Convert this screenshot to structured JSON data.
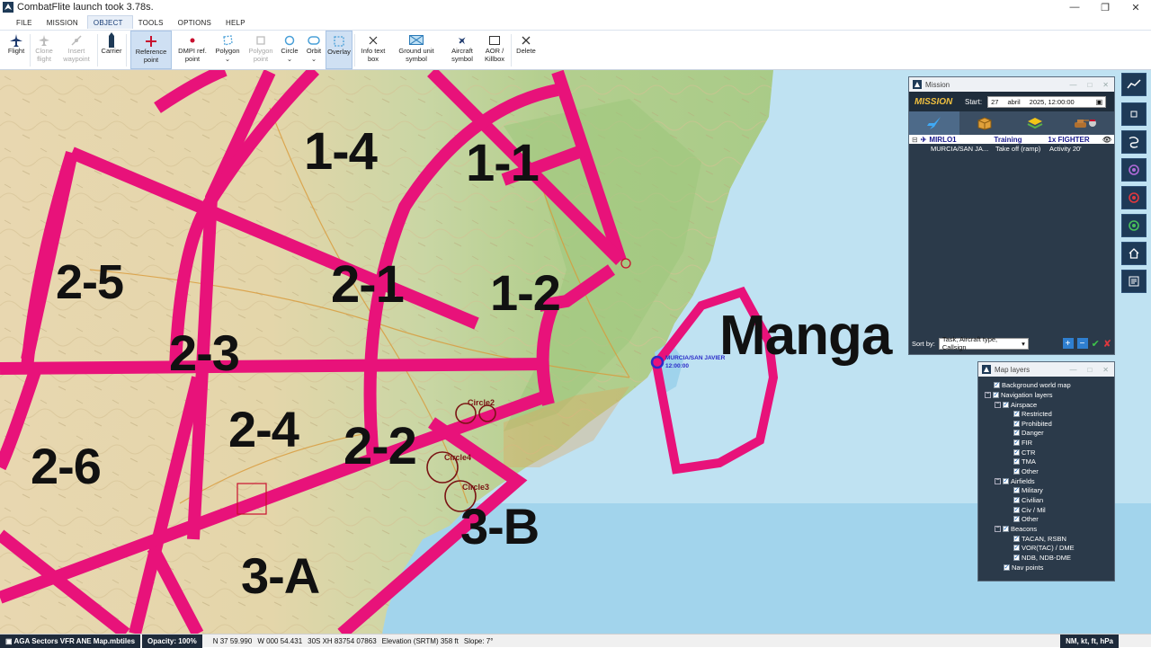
{
  "window": {
    "title": "CombatFlite launch took 3.78s."
  },
  "menu": [
    "FILE",
    "MISSION",
    "OBJECT",
    "TOOLS",
    "OPTIONS",
    "HELP"
  ],
  "ribbon": {
    "flight": "Flight",
    "clone": "Clone flight",
    "insert": "Insert waypoint",
    "carrier": "Carrier",
    "reference": "Reference point",
    "dmpi": "DMPI ref. point",
    "polygon": "Polygon",
    "polygon_point": "Polygon point",
    "circle": "Circle",
    "orbit": "Orbit",
    "overlay": "Overlay",
    "infotext": "Info text box",
    "ground": "Ground unit symbol",
    "aircraft": "Aircraft symbol",
    "aor": "AOR / Killbox",
    "delete": "Delete"
  },
  "map": {
    "sectors": [
      "1-4",
      "1-1",
      "2-5",
      "2-1",
      "1-2",
      "2-3",
      "2-4",
      "2-2",
      "2-6",
      "3-B",
      "3-A"
    ],
    "big_label": "Manga",
    "circles": [
      "Circle2",
      "Circle4",
      "Circle3"
    ],
    "airfield": "MURCIA/SAN JAVIER",
    "airfield_time": "12:00:00",
    "colors": {
      "sector": "#e8127a",
      "circle": "#7a1414",
      "water": "#bfe2f2"
    }
  },
  "mission": {
    "header": "Mission",
    "title": "MISSION",
    "start_label": "Start:",
    "day": "27",
    "month": "abril",
    "datetime": "2025, 12:00:00",
    "flight_name": "MIRLO1",
    "task": "Training",
    "aircraft": "1x FIGHTER",
    "route": "MURCIA/SAN JA...",
    "takeoff": "Take off (ramp)",
    "activity": "Activity 20'",
    "sort_label": "Sort by:",
    "sort_value": "Task, Aircraft type, Callsign"
  },
  "layers": {
    "header": "Map layers",
    "items": {
      "background": "Background world map",
      "navigation": "Navigation layers",
      "airspace": "Airspace",
      "restricted": "Restricted",
      "prohibited": "Prohibited",
      "danger": "Danger",
      "fir": "FIR",
      "ctr": "CTR",
      "tma": "TMA",
      "other1": "Other",
      "airfields": "Airfields",
      "military": "Military",
      "civilian": "Civilian",
      "civmil": "Civ / Mil",
      "other2": "Other",
      "beacons": "Beacons",
      "tacan": "TACAN, RSBN",
      "vor": "VOR(TAC) / DME",
      "ndb": "NDB, NDB-DME",
      "navpoints": "Nav points"
    }
  },
  "status": {
    "layer": "AGA Sectors VFR ANE Map.mbtiles",
    "opacity": "Opacity: 100%",
    "lat": "N 37 59.990",
    "lon": "W 000 54.431",
    "mgrs": "30S XH 83754 07863",
    "elevation": "Elevation (SRTM) 358 ft",
    "slope": "Slope: 7°",
    "units": "NM, kt, ft, hPa"
  }
}
